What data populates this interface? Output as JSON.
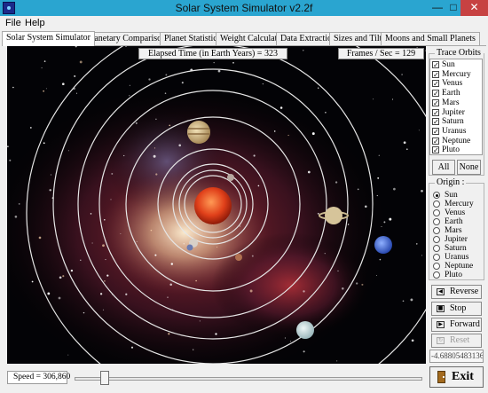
{
  "window": {
    "title": "Solar System Simulator v2.2f",
    "minimize": "—",
    "maximize": "□",
    "close": "✕"
  },
  "menu": [
    "File",
    "Help"
  ],
  "tabs": [
    {
      "label": "Solar System Simulator",
      "active": true
    },
    {
      "label": "Planetary Comparisons",
      "active": false
    },
    {
      "label": "Planet Statistics",
      "active": false
    },
    {
      "label": "Weight Calculator",
      "active": false
    },
    {
      "label": "Data Extraction",
      "active": false
    },
    {
      "label": "Sizes and Tilts",
      "active": false
    },
    {
      "label": "Moons and Small Planets",
      "active": false
    }
  ],
  "sim": {
    "elapsed": "Elapsed Time (in Earth Years) = 323",
    "fps": "Frames / Sec = 129"
  },
  "trace": {
    "title": "Trace Orbits :",
    "items": [
      {
        "label": "Sun",
        "checked": true
      },
      {
        "label": "Mercury",
        "checked": true
      },
      {
        "label": "Venus",
        "checked": true
      },
      {
        "label": "Earth",
        "checked": true
      },
      {
        "label": "Mars",
        "checked": true
      },
      {
        "label": "Jupiter",
        "checked": true
      },
      {
        "label": "Saturn",
        "checked": true
      },
      {
        "label": "Uranus",
        "checked": true
      },
      {
        "label": "Neptune",
        "checked": true
      },
      {
        "label": "Pluto",
        "checked": true
      }
    ],
    "all_label": "All",
    "none_label": "None"
  },
  "origin": {
    "title": "Origin :",
    "items": [
      {
        "label": "Sun",
        "selected": true
      },
      {
        "label": "Mercury",
        "selected": false
      },
      {
        "label": "Venus",
        "selected": false
      },
      {
        "label": "Earth",
        "selected": false
      },
      {
        "label": "Mars",
        "selected": false
      },
      {
        "label": "Jupiter",
        "selected": false
      },
      {
        "label": "Saturn",
        "selected": false
      },
      {
        "label": "Uranus",
        "selected": false
      },
      {
        "label": "Neptune",
        "selected": false
      },
      {
        "label": "Pluto",
        "selected": false
      }
    ]
  },
  "controls": {
    "reverse": {
      "label": "Reverse",
      "icon": "reverse-icon"
    },
    "stop": {
      "label": "Stop",
      "icon": "stop-icon"
    },
    "forward": {
      "label": "Forward",
      "icon": "forward-icon"
    },
    "reset": {
      "label": "Reset",
      "icon": "reset-icon",
      "disabled": true
    },
    "coordinate": "-4.68805483136",
    "exit": {
      "label": "Exit",
      "icon": "door-icon"
    }
  },
  "speed": {
    "label": "Speed = 306,860",
    "fraction": 0.075
  },
  "colors": {
    "titlebar": "#2aa5d0",
    "orbit": "#e6e6e6",
    "sun": "#e0401a",
    "close": "#c74242"
  }
}
